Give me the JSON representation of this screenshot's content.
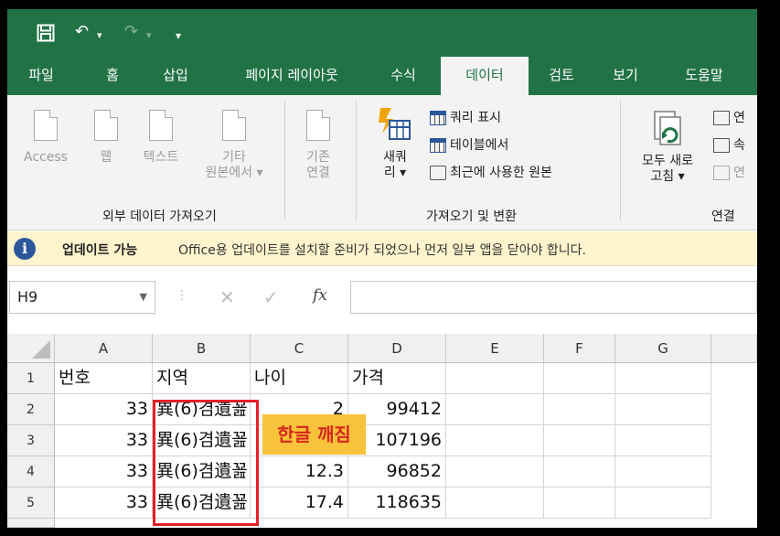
{
  "titlebar": {
    "save_icon": "save-icon",
    "undo_glyph": "↶",
    "redo_glyph": "↷",
    "dropdown_glyph": "▾"
  },
  "tabs": [
    {
      "label": "파일",
      "active": false
    },
    {
      "label": "홈",
      "active": false
    },
    {
      "label": "삽입",
      "active": false
    },
    {
      "label": "페이지 레이아웃",
      "active": false
    },
    {
      "label": "수식",
      "active": false
    },
    {
      "label": "데이터",
      "active": true
    },
    {
      "label": "검토",
      "active": false
    },
    {
      "label": "보기",
      "active": false
    },
    {
      "label": "도움말",
      "active": false
    }
  ],
  "ribbon": {
    "external_data": {
      "access": "Access",
      "web": "웹",
      "text": "텍스트",
      "other_line1": "기타",
      "other_line2": "원본에서 ▾",
      "existing_line1": "기존",
      "existing_line2": "연결",
      "group_label": "외부 데이터 가져오기"
    },
    "get_transform": {
      "new_query_line1": "새쿼",
      "new_query_line2": "리 ▾",
      "show_queries": "쿼리 표시",
      "from_table": "테이블에서",
      "recent_sources": "최근에 사용한 원본",
      "group_label": "가져오기 및 변환"
    },
    "connections": {
      "refresh_line1": "모두 새로",
      "refresh_line2": "고침 ▾",
      "conn1": "연",
      "conn2": "속",
      "conn3": "연",
      "group_label": "연결"
    }
  },
  "infobar": {
    "title": "업데이트 가능",
    "message": "Office용 업데이트를 설치할 준비가 되었으나 먼저 일부 앱을 닫아야 합니다."
  },
  "formula_bar": {
    "name_box": "H9",
    "cancel": "✕",
    "enter": "✓",
    "fx": "fx",
    "content": ""
  },
  "sheet": {
    "columns": [
      "A",
      "B",
      "C",
      "D",
      "E",
      "F",
      "G"
    ],
    "rows": [
      "1",
      "2",
      "3",
      "4",
      "5"
    ],
    "header_row": [
      "번호",
      "지역",
      "나이",
      "가격"
    ],
    "data": [
      [
        "33",
        "異(6)겸遺꾪",
        "2",
        "99412"
      ],
      [
        "33",
        "異(6)겸遺꾪",
        "",
        "107196"
      ],
      [
        "33",
        "異(6)겸遺꾪",
        "12.3",
        "96852"
      ],
      [
        "33",
        "異(6)겸遺꾪",
        "17.4",
        "118635"
      ]
    ]
  },
  "annotation": {
    "label": "한글 깨짐",
    "box_color": "#e3202a",
    "badge_color": "#f8c23a"
  },
  "colors": {
    "excel_green": "#217346",
    "info_blue": "#2b579a"
  }
}
